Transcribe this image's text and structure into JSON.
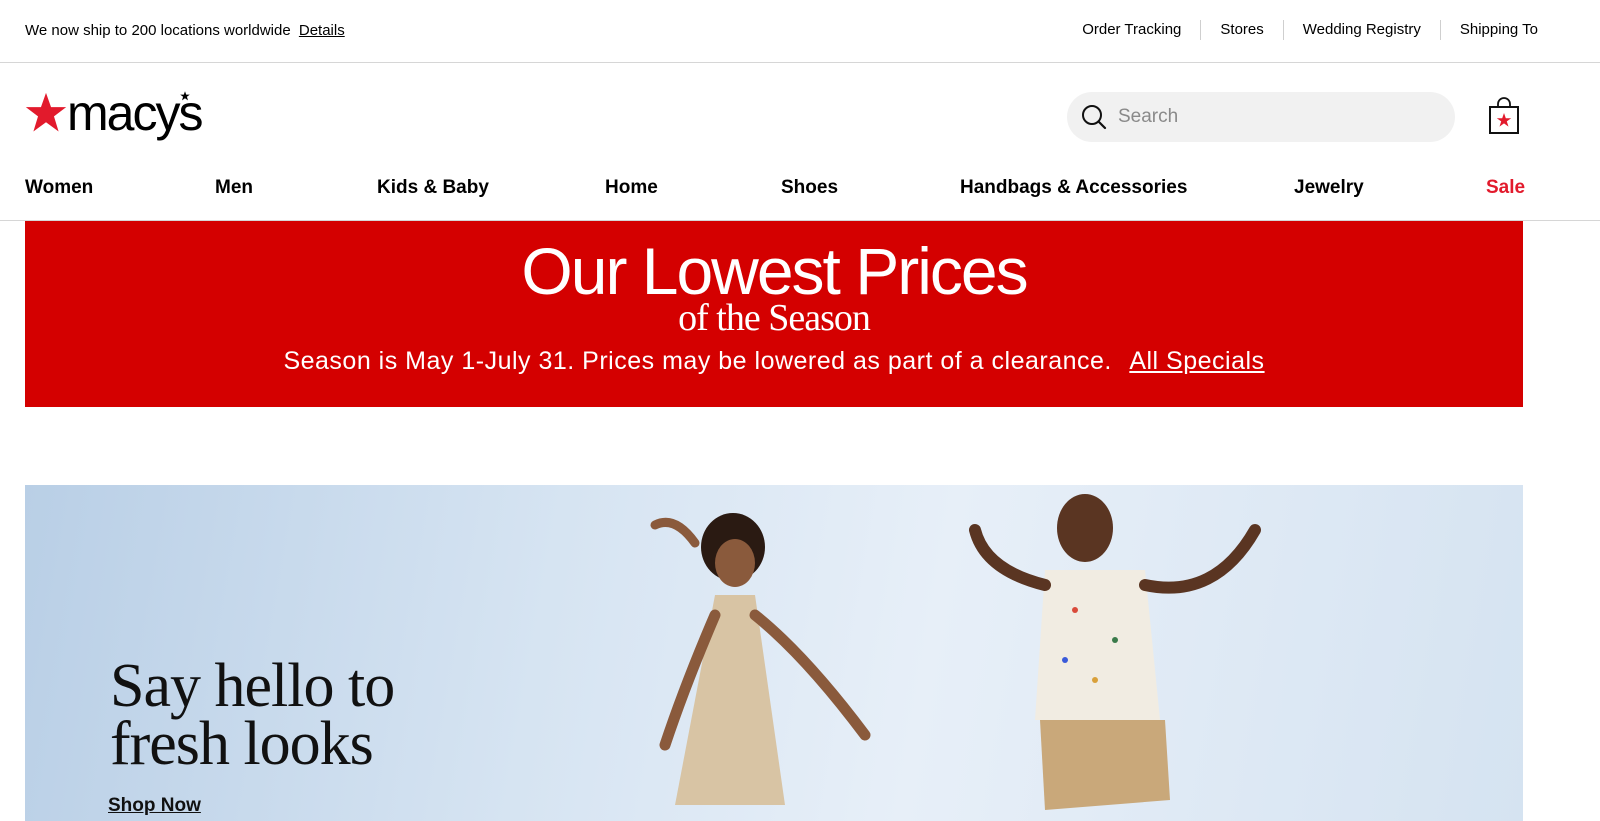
{
  "utility_bar": {
    "shipping_message": "We now ship to 200 locations worldwide",
    "details_link": "Details",
    "links": [
      "Order Tracking",
      "Stores",
      "Wedding Registry",
      "Shipping To"
    ]
  },
  "header": {
    "logo_text": "macys",
    "search_placeholder": "Search",
    "brand_color": "#e21a2c"
  },
  "nav": {
    "items": [
      "Women",
      "Men",
      "Kids & Baby",
      "Home",
      "Shoes",
      "Handbags & Accessories",
      "Jewelry",
      "Sale"
    ],
    "sale_color": "#e21a2c"
  },
  "promo": {
    "title": "Our Lowest Prices",
    "subtitle": "of the Season",
    "note": "Season is May 1-July 31. Prices may be lowered as part of a clearance.",
    "link": "All Specials",
    "background": "#d40000"
  },
  "hero": {
    "heading_line1": "Say hello to",
    "heading_line2": "fresh looks",
    "cta": "Shop Now"
  }
}
